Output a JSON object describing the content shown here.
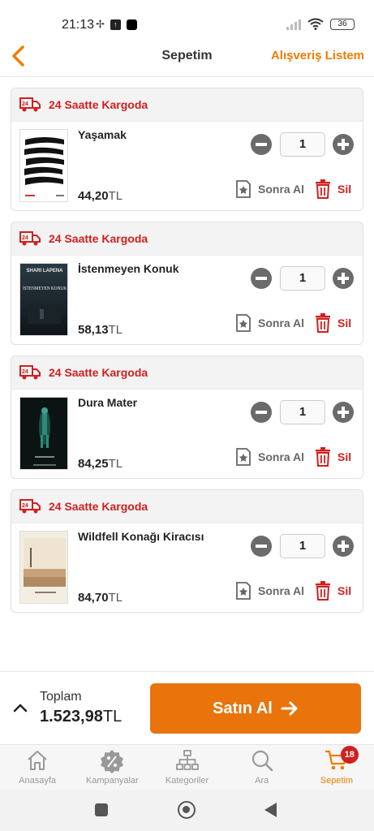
{
  "status_bar": {
    "time": "21:13",
    "battery": "36"
  },
  "header": {
    "title": "Sepetim",
    "shopping_list_link": "Alışveriş Listem"
  },
  "cart": {
    "shipping_label": "24 Saatte Kargoda",
    "later_label": "Sonra Al",
    "delete_label": "Sil",
    "items": [
      {
        "title": "Yaşamak",
        "price": "44,20",
        "currency": "TL",
        "quantity": "1"
      },
      {
        "title": "İstenmeyen Konuk",
        "price": "58,13",
        "currency": "TL",
        "quantity": "1"
      },
      {
        "title": "Dura Mater",
        "price": "84,25",
        "currency": "TL",
        "quantity": "1"
      },
      {
        "title": "Wildfell Konağı Kiracısı",
        "price": "84,70",
        "currency": "TL",
        "quantity": "1"
      }
    ]
  },
  "covers": {
    "cover2_author": "SHARI LAPENA",
    "cover2_title": "İSTENMEYEN KONUK"
  },
  "checkout": {
    "total_label": "Toplam",
    "total_value": "1.523,98",
    "currency": "TL",
    "buy_label": "Satın Al"
  },
  "tabs": [
    {
      "label": "Anasayfa",
      "icon": "home-icon"
    },
    {
      "label": "Kampanyalar",
      "icon": "percent-badge-icon"
    },
    {
      "label": "Kategoriler",
      "icon": "hierarchy-icon"
    },
    {
      "label": "Ara",
      "icon": "search-icon"
    },
    {
      "label": "Sepetim",
      "icon": "cart-icon",
      "badge": "18",
      "active": true
    }
  ],
  "colors": {
    "accent": "#f07c00",
    "buy_button": "#e8740b",
    "danger": "#d21f1f"
  }
}
